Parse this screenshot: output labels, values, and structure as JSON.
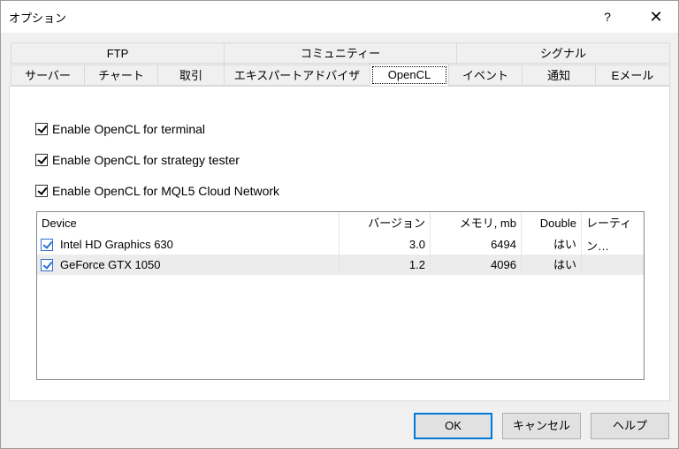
{
  "window": {
    "title": "オプション",
    "help": "?",
    "close": "✕"
  },
  "tabs_top": [
    "FTP",
    "コミュニティー",
    "シグナル"
  ],
  "tabs_bottom": [
    "サーバー",
    "チャート",
    "取引",
    "エキスパートアドバイザ",
    "OpenCL",
    "イベント",
    "通知",
    "Eメール"
  ],
  "active_tab": "OpenCL",
  "checks": [
    {
      "label": "Enable OpenCL for terminal",
      "checked": true
    },
    {
      "label": "Enable OpenCL for strategy tester",
      "checked": true
    },
    {
      "label": "Enable OpenCL for MQL5 Cloud Network",
      "checked": true
    }
  ],
  "table": {
    "headers": [
      "Device",
      "バージョン",
      "メモリ, mb",
      "Double",
      "レーティン…"
    ],
    "rows": [
      {
        "checked": true,
        "device": "Intel HD Graphics 630",
        "version": "3.0",
        "memory": "6494",
        "double": "はい",
        "rating": ""
      },
      {
        "checked": true,
        "device": "GeForce GTX 1050",
        "version": "1.2",
        "memory": "4096",
        "double": "はい",
        "rating": ""
      }
    ]
  },
  "buttons": {
    "ok": "OK",
    "cancel": "キャンセル",
    "help": "ヘルプ"
  },
  "colors": {
    "accent": "#0078d7",
    "selected_row": "#ececec"
  }
}
